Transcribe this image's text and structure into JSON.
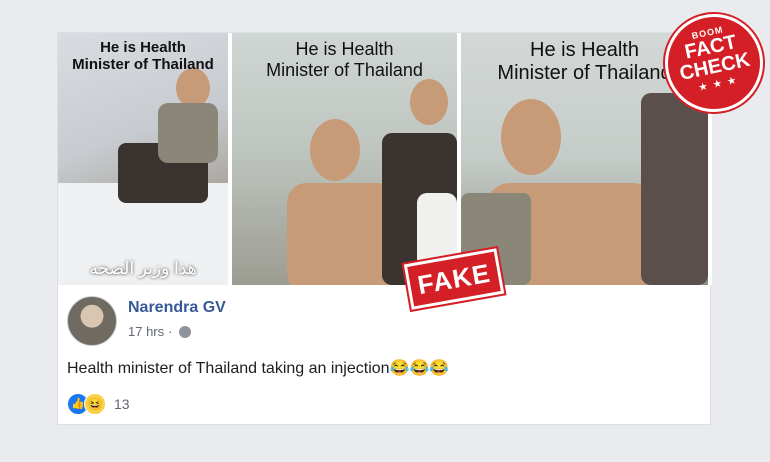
{
  "photos": [
    {
      "caption_line1": "He is Health",
      "caption_line2": "Minister of Thailand",
      "overlay_text": "هذا وزير الصحه"
    },
    {
      "caption_line1": "He is Health",
      "caption_line2": "Minister of Thailand"
    },
    {
      "caption_line1": "He is Health",
      "caption_line2": "Minister of Thailand"
    }
  ],
  "stamps": {
    "fake": "FAKE",
    "factcheck_brand": "BOOM",
    "factcheck_line1": "FACT",
    "factcheck_line2": "CHECK",
    "factcheck_stars": "★ ★ ★"
  },
  "post": {
    "author": "Narendra GV",
    "time": "17 hrs",
    "separator": "·",
    "text": "Health minister of Thailand taking an injection😂😂😂",
    "reaction_count": "13"
  },
  "icons": {
    "like": "👍",
    "haha": "😆"
  },
  "colors": {
    "stamp_red": "#d51f26",
    "author_blue": "#385898"
  }
}
